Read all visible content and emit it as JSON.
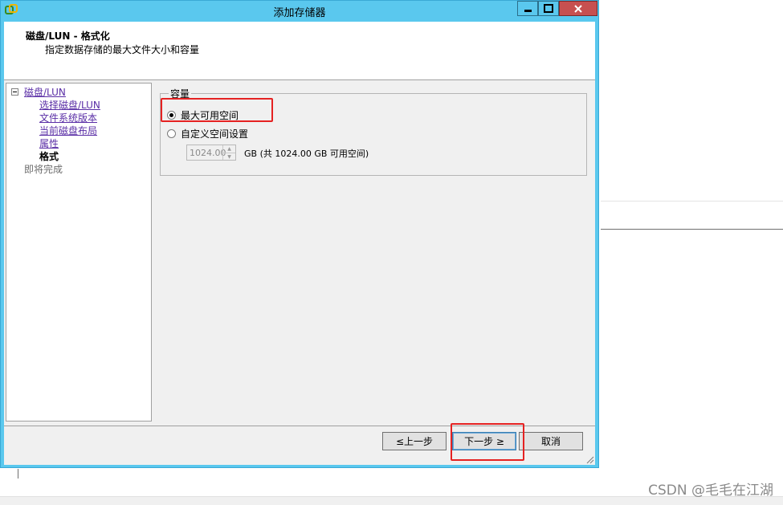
{
  "window": {
    "title": "添加存储器"
  },
  "header": {
    "title": "磁盘/LUN - 格式化",
    "subtitle": "指定数据存储的最大文件大小和容量"
  },
  "nav": {
    "root": "磁盘/LUN",
    "items": [
      {
        "label": "选择磁盘/LUN",
        "state": "link"
      },
      {
        "label": "文件系统版本",
        "state": "link"
      },
      {
        "label": "当前磁盘布局",
        "state": "link"
      },
      {
        "label": "属性",
        "state": "link"
      },
      {
        "label": "格式",
        "state": "current"
      },
      {
        "label": "即将完成",
        "state": "disabled"
      }
    ]
  },
  "capacity": {
    "legend": "容量",
    "option_max": "最大可用空间",
    "option_custom": "自定义空间设置",
    "selected": "max",
    "spin_value": "1024.00",
    "unit_text": "GB (共 1024.00 GB 可用空间)"
  },
  "buttons": {
    "back": "≤上一步",
    "next": "下一步 ≥",
    "cancel": "取消"
  },
  "watermark": "CSDN @毛毛在江湖",
  "colors": {
    "titlebar": "#5ac8ee",
    "close_button": "#c75050",
    "link": "#5a2ea6",
    "annotation": "#e52222"
  }
}
